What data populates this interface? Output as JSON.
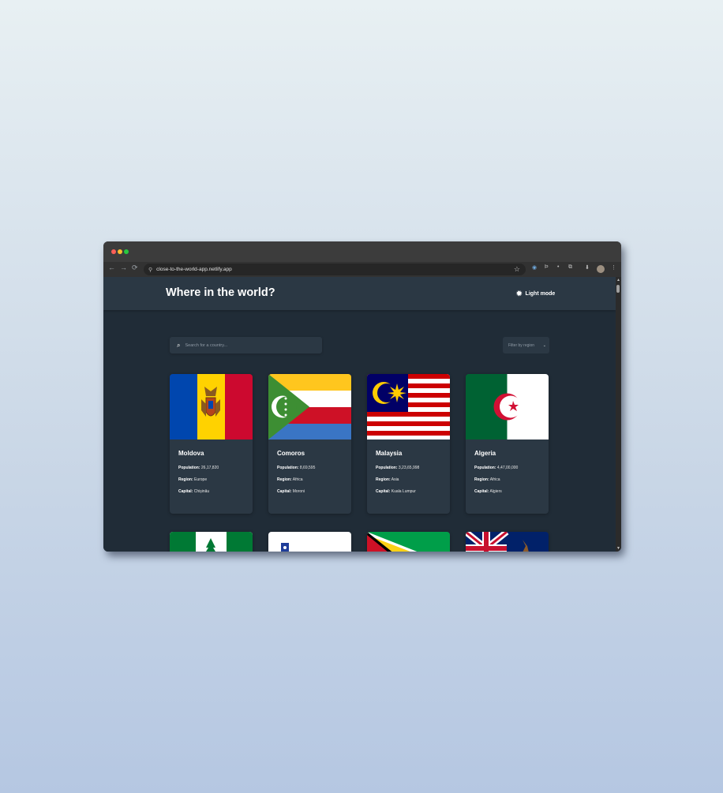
{
  "browser": {
    "url": "close-to-the-world-app.netlify.app",
    "nav_back": "←",
    "nav_forward": "→",
    "nav_reload": "⟳",
    "star": "☆",
    "ext_icons": [
      "◉",
      "Þ",
      "•",
      "⧉",
      "⬇",
      "⋮"
    ]
  },
  "header": {
    "title": "Where in the world?",
    "mode_label": "Light mode",
    "mode_icon": "✹"
  },
  "search": {
    "placeholder": "Search for a country...",
    "icon": "⌕"
  },
  "filter": {
    "label": "Filter by region",
    "chevron": "⌄"
  },
  "labels": {
    "population": "Population:",
    "region": "Region:",
    "capital": "Capital:"
  },
  "countries": [
    {
      "name": "Moldova",
      "population": "26,17,820",
      "region": "Europe",
      "capital": "Chișinău"
    },
    {
      "name": "Comoros",
      "population": "8,69,595",
      "region": "Africa",
      "capital": "Moroni"
    },
    {
      "name": "Malaysia",
      "population": "3,23,65,998",
      "region": "Asia",
      "capital": "Kuala Lumpur"
    },
    {
      "name": "Algeria",
      "population": "4,47,00,000",
      "region": "Africa",
      "capital": "Algiers"
    }
  ],
  "colors": {
    "page_bg": "#202c37",
    "element_bg": "#2b3844",
    "text": "#ffffff"
  }
}
